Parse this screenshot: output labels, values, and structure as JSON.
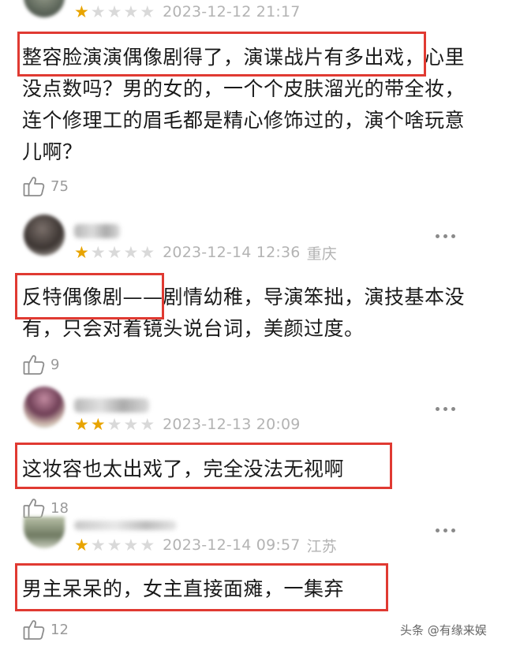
{
  "reviews": [
    {
      "rating": 1,
      "max_rating": 5,
      "datetime": "2023-12-12 21:17",
      "location": "",
      "text": "整容脸演演偶像剧得了，演谍战片有多出戏，心里没点数吗？男的女的，一个个皮肤溜光的带全妆，连个修理工的眉毛都是精心修饰过的，演个啥玩意儿啊？",
      "likes": "75"
    },
    {
      "rating": 1,
      "max_rating": 5,
      "datetime": "2023-12-14 12:36",
      "location": "重庆",
      "text": "反特偶像剧——剧情幼稚，导演笨拙，演技基本没有，只会对着镜头说台词，美颜过度。",
      "likes": "9"
    },
    {
      "rating": 2,
      "max_rating": 5,
      "datetime": "2023-12-13 20:09",
      "location": "",
      "text": "这妆容也太出戏了，完全没法无视啊",
      "likes": "18"
    },
    {
      "rating": 1,
      "max_rating": 5,
      "datetime": "2023-12-14 09:57",
      "location": "江苏",
      "text": "男主呆呆的，女主直接面瘫，一集弃",
      "likes": "12"
    }
  ],
  "watermark": "头条 @有缘来娱",
  "colors": {
    "highlight": "#e03a32",
    "star_on": "#e8a400",
    "star_off": "#d9d9d9",
    "meta": "#b3b3b3"
  },
  "icons": {
    "like": "thumbs-up-icon",
    "more": "more-dots-icon",
    "star": "star-icon"
  }
}
